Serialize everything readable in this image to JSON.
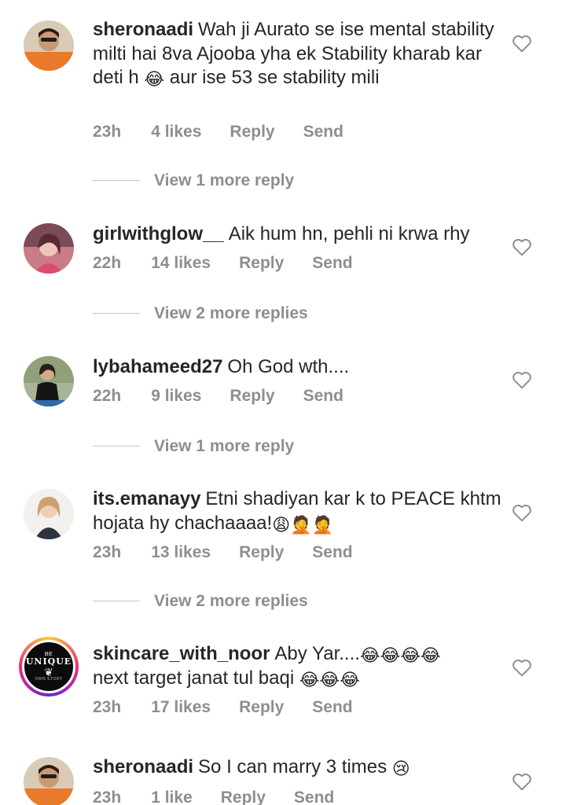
{
  "comments": [
    {
      "username": "sheronaadi",
      "text_parts": [
        "Wah ji Aurato se ise mental stability milti hai 8va Ajooba yha ek Stability kharab kar deti h ",
        " aur ise 53 se stability mili"
      ],
      "emoji": "😂",
      "time": "23h",
      "likes": "4 likes",
      "reply": "Reply",
      "send": "Send",
      "view_replies": "View 1 more reply"
    },
    {
      "username": "girlwithglow__",
      "text": "Aik hum hn, pehli ni krwa rhy",
      "time": "22h",
      "likes": "14 likes",
      "reply": "Reply",
      "send": "Send",
      "view_replies": "View 2 more replies"
    },
    {
      "username": "lybahameed27",
      "text": "Oh God wth....",
      "time": "22h",
      "likes": "9 likes",
      "reply": "Reply",
      "send": "Send",
      "view_replies": "View 1 more reply"
    },
    {
      "username": "its.emanayy",
      "text": "Etni shadiyan kar k to PEACE khtm hojata hy chachaaaa!",
      "emoji": "😩🤦🤦",
      "time": "23h",
      "likes": "13 likes",
      "reply": "Reply",
      "send": "Send",
      "view_replies": "View 2 more replies"
    },
    {
      "username": "skincare_with_noor",
      "text_parts": [
        "Aby Yar....",
        " next target janat tul baqi "
      ],
      "emoji_a": "😂😂😂😂",
      "emoji_b": "😂😂😂",
      "time": "23h",
      "likes": "17 likes",
      "reply": "Reply",
      "send": "Send",
      "avatar_logo": {
        "top": "BE",
        "main": "UNIQUE",
        "bottom": "OWN STORY"
      }
    },
    {
      "username": "sheronaadi",
      "text": "So I can marry 3 times ",
      "emoji": "😢",
      "time": "23h",
      "likes": "1 like",
      "reply": "Reply",
      "send": "Send"
    }
  ],
  "icons": {
    "heart": "heart-outline-icon"
  },
  "colors": {
    "text": "#262626",
    "secondary": "#8e8e8e",
    "divider": "#c7c7c7"
  }
}
